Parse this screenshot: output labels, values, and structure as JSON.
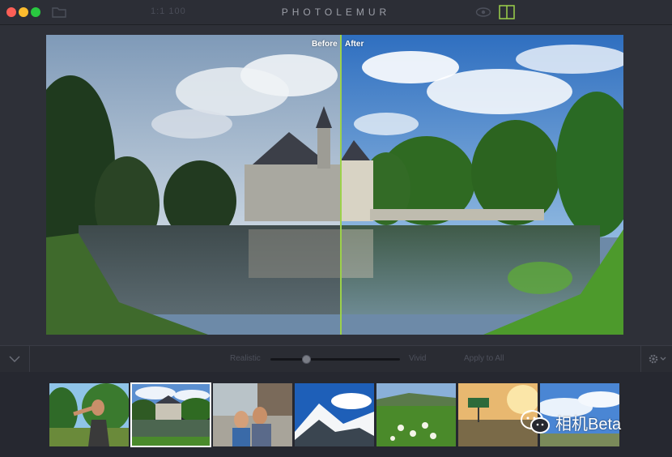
{
  "window": {
    "title": "PHOTOLEMUR",
    "zoom_text": "1:1  100"
  },
  "compare": {
    "before_label": "Before",
    "after_label": "After",
    "split_color": "#9cd14a"
  },
  "controls": {
    "realistic_label": "Realistic",
    "vivid_label": "Vivid",
    "apply_all_label": "Apply to All",
    "slider_value": 0.26
  },
  "filmstrip": {
    "thumbnails": [
      {
        "subject": "woman-portrait"
      },
      {
        "subject": "castle",
        "selected": true
      },
      {
        "subject": "couple-selfie"
      },
      {
        "subject": "snowy-mountain"
      },
      {
        "subject": "field-flowers"
      },
      {
        "subject": "sunset-sign"
      },
      {
        "subject": "sky-clouds"
      }
    ]
  },
  "watermark": {
    "text": "相机Beta"
  },
  "colors": {
    "accent": "#9cd14a",
    "background": "#2b2d35"
  }
}
